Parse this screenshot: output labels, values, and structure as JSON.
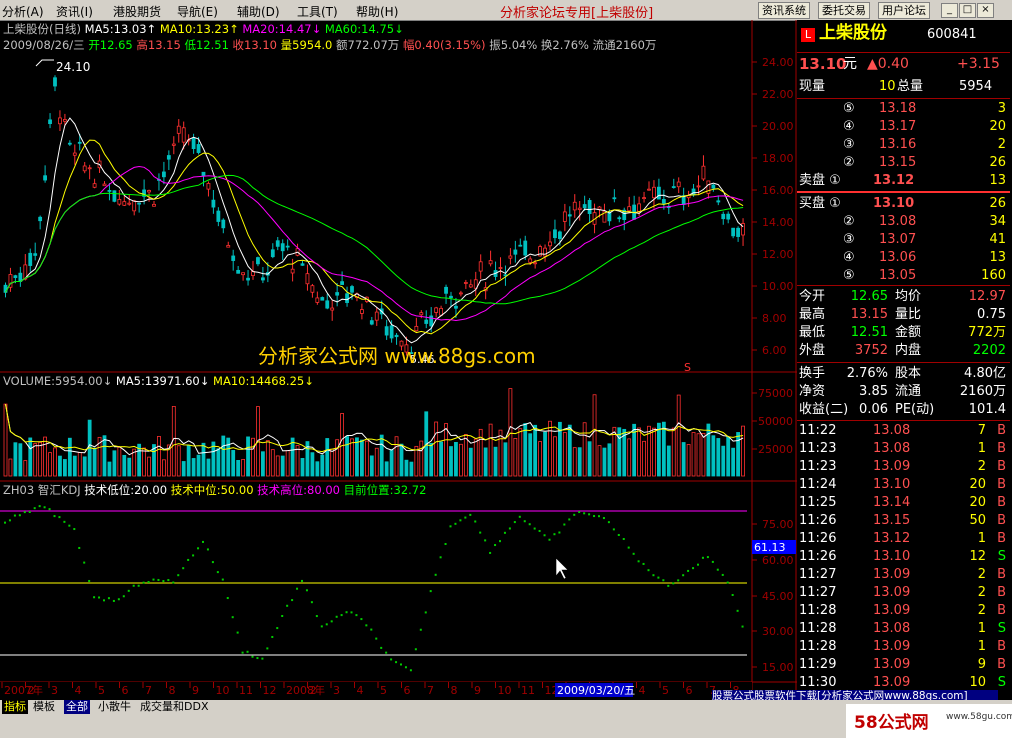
{
  "menu": {
    "items": [
      "分析(A)",
      "资讯(I)",
      "港股期货",
      "导航(E)",
      "辅助(D)",
      "工具(T)",
      "帮助(H)"
    ],
    "title": "分析家论坛专用[上柴股份]",
    "buttons": [
      "资讯系统",
      "委托交易",
      "用户论坛"
    ],
    "window_controls": [
      "_",
      "□",
      "×"
    ]
  },
  "info": {
    "line1": [
      {
        "text": "上柴股份(日线)",
        "color": "#c0c0c0"
      },
      {
        "text": "MA5:13.03↑",
        "color": "#ffffff"
      },
      {
        "text": "MA10:13.23↑",
        "color": "#ffff00"
      },
      {
        "text": "MA20:14.47↓",
        "color": "#ff00ff"
      },
      {
        "text": "MA60:14.75↓",
        "color": "#00ff00"
      }
    ],
    "line2": [
      {
        "text": "2009/08/26/三",
        "color": "#c0c0c0"
      },
      {
        "text": "开12.65",
        "color": "#00ff00"
      },
      {
        "text": "高13.15",
        "color": "#ff5050"
      },
      {
        "text": "低12.51",
        "color": "#00ff00"
      },
      {
        "text": "收13.10",
        "color": "#ff5050"
      },
      {
        "text": "量5954.0",
        "color": "#ffff00"
      },
      {
        "text": "额772.07万",
        "color": "#c0c0c0"
      },
      {
        "text": "幅0.40(3.15%)",
        "color": "#ff5050"
      },
      {
        "text": "振5.04%",
        "color": "#c0c0c0"
      },
      {
        "text": "换2.76%",
        "color": "#c0c0c0"
      },
      {
        "text": "流通2160万",
        "color": "#c0c0c0"
      }
    ],
    "high_marker": "24.10",
    "low_marker": "5.46",
    "watermark": "分析家公式网 www.88gs.com",
    "s_marker": "S"
  },
  "price_axis": [
    "24.00",
    "22.00",
    "20.00",
    "18.00",
    "16.00",
    "14.00",
    "12.00",
    "10.00",
    "8.00",
    "6.00"
  ],
  "volume": {
    "header": [
      {
        "text": "VOLUME:5954.00↓",
        "color": "#c0c0c0"
      },
      {
        "text": "MA5:13971.60↓",
        "color": "#ffffff"
      },
      {
        "text": "MA10:14468.25↓",
        "color": "#ffff00"
      }
    ],
    "axis": [
      "75000",
      "50000",
      "25000"
    ]
  },
  "kdj": {
    "header": [
      {
        "text": "ZH03 智汇KDJ",
        "color": "#c0c0c0"
      },
      {
        "text": "技术低位:20.00",
        "color": "#ffffff"
      },
      {
        "text": "技术中位:50.00",
        "color": "#ffff00"
      },
      {
        "text": "技术高位:80.00",
        "color": "#ff00ff"
      },
      {
        "text": "目前位置:32.72",
        "color": "#00ff00"
      }
    ],
    "axis": [
      "75.00",
      "60.00",
      "45.00",
      "30.00",
      "15.00"
    ],
    "current_label": "61.13"
  },
  "date_axis": {
    "labels": [
      "2007年",
      "2",
      "3",
      "4",
      "5",
      "6",
      "7",
      "8",
      "9",
      "10",
      "11",
      "12",
      "2008年",
      "2",
      "3",
      "4",
      "5",
      "6",
      "7",
      "8",
      "9",
      "10",
      "11",
      "12",
      "2009年",
      "2",
      "3",
      "4",
      "5",
      "6",
      "7",
      "8"
    ],
    "highlight": "2009/03/20/五"
  },
  "quote": {
    "name": "上柴股份",
    "code": "600841",
    "price": "13.10",
    "unit": "元",
    "change": "▲0.40",
    "change_pct": "+3.15",
    "xianliang_label": "现量",
    "xianliang": "10",
    "zongliang_label": "总量",
    "zongliang": "5954",
    "sell": [
      {
        "lvl": "⑤",
        "price": "13.18",
        "vol": "3"
      },
      {
        "lvl": "④",
        "price": "13.17",
        "vol": "20"
      },
      {
        "lvl": "③",
        "price": "13.16",
        "vol": "2"
      },
      {
        "lvl": "②",
        "price": "13.15",
        "vol": "26"
      },
      {
        "lvl": "卖盘 ①",
        "price": "13.12",
        "vol": "13"
      }
    ],
    "buy": [
      {
        "lvl": "买盘 ①",
        "price": "13.10",
        "vol": "26"
      },
      {
        "lvl": "②",
        "price": "13.08",
        "vol": "34"
      },
      {
        "lvl": "③",
        "price": "13.07",
        "vol": "41"
      },
      {
        "lvl": "④",
        "price": "13.06",
        "vol": "13"
      },
      {
        "lvl": "⑤",
        "price": "13.05",
        "vol": "160"
      }
    ],
    "stats": [
      {
        "l1": "今开",
        "v1": "12.65",
        "c1": "#00ff00",
        "l2": "均价",
        "v2": "12.97",
        "c2": "#ff5050"
      },
      {
        "l1": "最高",
        "v1": "13.15",
        "c1": "#ff5050",
        "l2": "量比",
        "v2": "0.75",
        "c2": "#ffffff"
      },
      {
        "l1": "最低",
        "v1": "12.51",
        "c1": "#00ff00",
        "l2": "金额",
        "v2": "772万",
        "c2": "#ffff00"
      },
      {
        "l1": "外盘",
        "v1": "3752",
        "c1": "#ff5050",
        "l2": "内盘",
        "v2": "2202",
        "c2": "#00ff00"
      }
    ],
    "stats2": [
      {
        "l1": "换手",
        "v1": "2.76%",
        "l2": "股本",
        "v2": "4.80亿"
      },
      {
        "l1": "净资",
        "v1": "3.85",
        "l2": "流通",
        "v2": "2160万"
      },
      {
        "l1": "收益(二)",
        "v1": "0.06",
        "l2": "PE(动)",
        "v2": "101.4"
      }
    ],
    "ticks": [
      {
        "t": "11:22",
        "p": "13.08",
        "v": "7",
        "d": "B"
      },
      {
        "t": "11:23",
        "p": "13.08",
        "v": "1",
        "d": "B"
      },
      {
        "t": "11:23",
        "p": "13.09",
        "v": "2",
        "d": "B"
      },
      {
        "t": "11:24",
        "p": "13.10",
        "v": "20",
        "d": "B"
      },
      {
        "t": "11:25",
        "p": "13.14",
        "v": "20",
        "d": "B"
      },
      {
        "t": "11:26",
        "p": "13.15",
        "v": "50",
        "d": "B"
      },
      {
        "t": "11:26",
        "p": "13.12",
        "v": "1",
        "d": "B"
      },
      {
        "t": "11:26",
        "p": "13.10",
        "v": "12",
        "d": "S"
      },
      {
        "t": "11:27",
        "p": "13.09",
        "v": "2",
        "d": "B"
      },
      {
        "t": "11:27",
        "p": "13.09",
        "v": "2",
        "d": "B"
      },
      {
        "t": "11:28",
        "p": "13.09",
        "v": "2",
        "d": "B"
      },
      {
        "t": "11:28",
        "p": "13.08",
        "v": "1",
        "d": "S"
      },
      {
        "t": "11:28",
        "p": "13.09",
        "v": "1",
        "d": "B"
      },
      {
        "t": "11:29",
        "p": "13.09",
        "v": "9",
        "d": "B"
      },
      {
        "t": "11:30",
        "p": "13.09",
        "v": "10",
        "d": "S"
      }
    ]
  },
  "bottom": {
    "tabs": [
      "指标",
      "模板",
      "全部",
      "小散牛",
      "成交量和DDX"
    ],
    "ad": "股票公式股票软件下载[分析家公式网www.88gs.com]",
    "logo": "58公式网",
    "logo_url": "www.58gu.com"
  },
  "colors": {
    "up": "#ff3030",
    "down": "#00c0c0",
    "ma5": "#ffffff",
    "ma10": "#ffff00",
    "ma20": "#ff00ff",
    "ma60": "#00ff00",
    "grid": "#a00000"
  }
}
